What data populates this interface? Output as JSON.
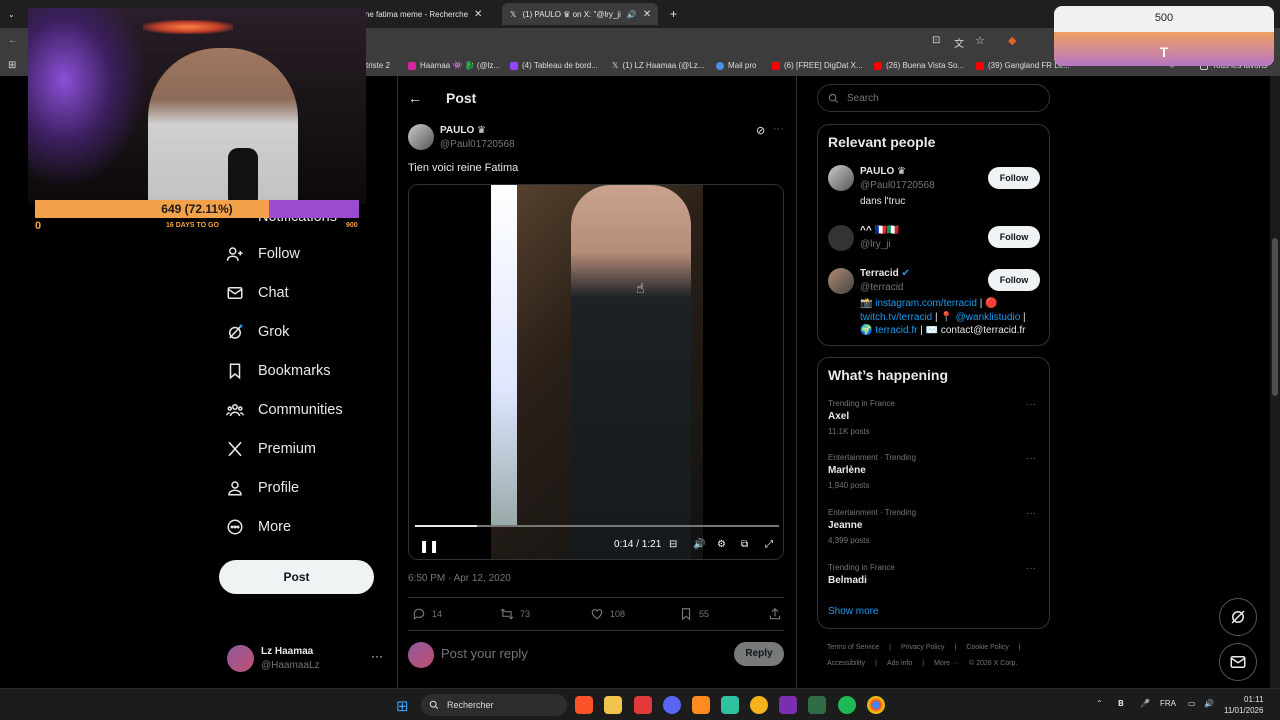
{
  "browser": {
    "tabs": [
      {
        "label": "reine fatima meme - Recherche",
        "active": false
      },
      {
        "label": "(1) PAULO ♛ on X: \"@lry_ji",
        "active": true
      }
    ],
    "bookmarks": [
      "triste 2",
      "Haamaa 👾 🐉 (@lz...",
      "(4) Tableau de bord...",
      "(1) LZ Haamaa (@Lz...",
      "Mail pro",
      "(6) [FREE] DigDat X...",
      "(26) Buena Vista So...",
      "(39) Gangland FR Le...",
      "Tous les favoris"
    ]
  },
  "overlay": {
    "progress_label": "649 (72.11%)",
    "progress_fraction": 0.7211,
    "min": "0",
    "days_to_go": "16 DAYS TO GO",
    "max": "900",
    "widget_number": "500",
    "widget_letter": "T"
  },
  "nav": {
    "partial": "Notifications",
    "items": [
      {
        "label": "Follow",
        "icon": "add-person-icon"
      },
      {
        "label": "Chat",
        "icon": "mail-icon"
      },
      {
        "label": "Grok",
        "icon": "grok-icon"
      },
      {
        "label": "Bookmarks",
        "icon": "bookmark-icon"
      },
      {
        "label": "Communities",
        "icon": "communities-icon"
      },
      {
        "label": "Premium",
        "icon": "x-logo-icon"
      },
      {
        "label": "Profile",
        "icon": "person-icon"
      },
      {
        "label": "More",
        "icon": "more-circle-icon"
      }
    ],
    "post_button": "Post",
    "account": {
      "name": "Lz Haamaa",
      "handle": "@HaamaaLz",
      "more": "···"
    }
  },
  "post": {
    "header": "Post",
    "author_name": "PAULO ♛",
    "author_handle": "@Paul01720568",
    "text": "Tien voici reine Fatima",
    "video_time": "0:14 / 1:21",
    "video_progress": 0.17,
    "timestamp": "6:50 PM · Apr 12, 2020",
    "replies": "14",
    "reposts": "73",
    "likes": "108",
    "bookmarks": "55",
    "reply_placeholder": "Post your reply",
    "reply_button": "Reply"
  },
  "sidebar": {
    "search_placeholder": "Search",
    "relevant_title": "Relevant people",
    "people": [
      {
        "name": "PAULO ♛",
        "handle": "@Paul01720568",
        "bio": "dans l'truc",
        "follow": "Follow"
      },
      {
        "name": "^^ 🇫🇷🇮🇹",
        "handle": "@lry_ji",
        "bio": "",
        "follow": "Follow"
      },
      {
        "name": "Terracid",
        "handle": "@terracid",
        "follow": "Follow",
        "bio_parts": [
          "📸 ",
          "instagram.com/terracid",
          " | 🔴 ",
          "twitch.tv/terracid",
          " | 📍 ",
          "@wanklistudio",
          " | 🌍 ",
          "terracid.fr",
          " | ✉️ contact@terracid.fr"
        ]
      }
    ],
    "happening_title": "What’s happening",
    "trends": [
      {
        "category": "Trending in France",
        "name": "Axel",
        "count": "11.1K posts"
      },
      {
        "category": "Entertainment · Trending",
        "name": "Marlène",
        "count": "1,940 posts"
      },
      {
        "category": "Entertainment · Trending",
        "name": "Jeanne",
        "count": "4,399 posts"
      },
      {
        "category": "Trending in France",
        "name": "Belmadi",
        "count": ""
      }
    ],
    "show_more": "Show more",
    "footer_line1": [
      "Terms of Service",
      "|",
      "Privacy Policy",
      "|",
      "Cookie Policy",
      "|"
    ],
    "footer_line2": [
      "Accessibility",
      "|",
      "Ads info",
      "|",
      "More ···",
      "© 2026 X Corp."
    ]
  },
  "taskbar": {
    "search": "Rechercher",
    "lang": "FRA",
    "time": "01:11",
    "date": "11/01/2026"
  },
  "colors": {
    "accent": "#1d9bf0",
    "progress_orange": "#f4a24a",
    "progress_purple": "#9b4bd0"
  }
}
